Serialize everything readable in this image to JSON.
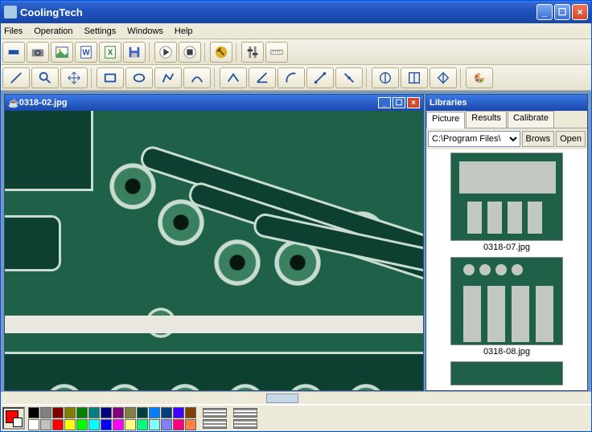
{
  "window": {
    "title": "CoolingTech"
  },
  "menu": {
    "items": [
      "Files",
      "Operation",
      "Settings",
      "Windows",
      "Help"
    ]
  },
  "toolbar1": {
    "icons": [
      "film",
      "camera",
      "picture",
      "word",
      "excel",
      "save",
      "play",
      "stop",
      "wrench",
      "sliders",
      "ruler"
    ]
  },
  "toolbar2": {
    "icons": [
      "line",
      "magnify",
      "arrows",
      "rect",
      "ellipse",
      "poly",
      "curve",
      "path",
      "angle",
      "arc",
      "compass",
      "compass2",
      "phi1",
      "phi2",
      "phi3",
      "palette"
    ]
  },
  "image_window": {
    "filename": "0318-02.jpg"
  },
  "libraries": {
    "title": "Libraries",
    "tabs": [
      "Picture",
      "Results",
      "Calibrate"
    ],
    "active_tab": 0,
    "path": "C:\\Program Files\\",
    "browse": "Brows",
    "open": "Open",
    "thumbs": [
      "0318-07.jpg",
      "0318-08.jpg"
    ]
  },
  "palette": {
    "row1": [
      "#000000",
      "#808080",
      "#800000",
      "#808000",
      "#008000",
      "#008080",
      "#000080",
      "#800080",
      "#808040",
      "#004040",
      "#0080ff",
      "#004080",
      "#4000ff",
      "#804000"
    ],
    "row2": [
      "#ffffff",
      "#c0c0c0",
      "#ff0000",
      "#ffff00",
      "#00ff00",
      "#00ffff",
      "#0000ff",
      "#ff00ff",
      "#ffff80",
      "#00ff80",
      "#80ffff",
      "#8080ff",
      "#ff0080",
      "#ff8040"
    ]
  }
}
